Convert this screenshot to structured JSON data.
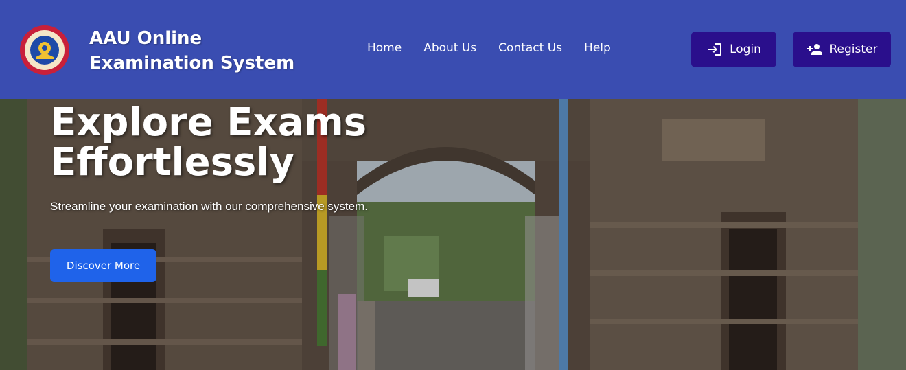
{
  "brand": {
    "line1": "AAU Online",
    "line2": "Examination System",
    "logo_icon": "aau-seal-logo"
  },
  "nav": {
    "links": [
      "Home",
      "About Us",
      "Contact Us",
      "Help"
    ],
    "login_label": "Login",
    "register_label": "Register",
    "login_icon": "login-arrow-icon",
    "register_icon": "person-add-icon"
  },
  "hero": {
    "title_line1": "Explore Exams",
    "title_line2": "Effortlessly",
    "subtitle": "Streamline your examination with our comprehensive system.",
    "cta_label": "Discover More",
    "background": "university-gate-photo"
  },
  "colors": {
    "navbar": "#3a4db1",
    "nav_button": "#2a0f8c",
    "cta": "#1f63ea"
  }
}
